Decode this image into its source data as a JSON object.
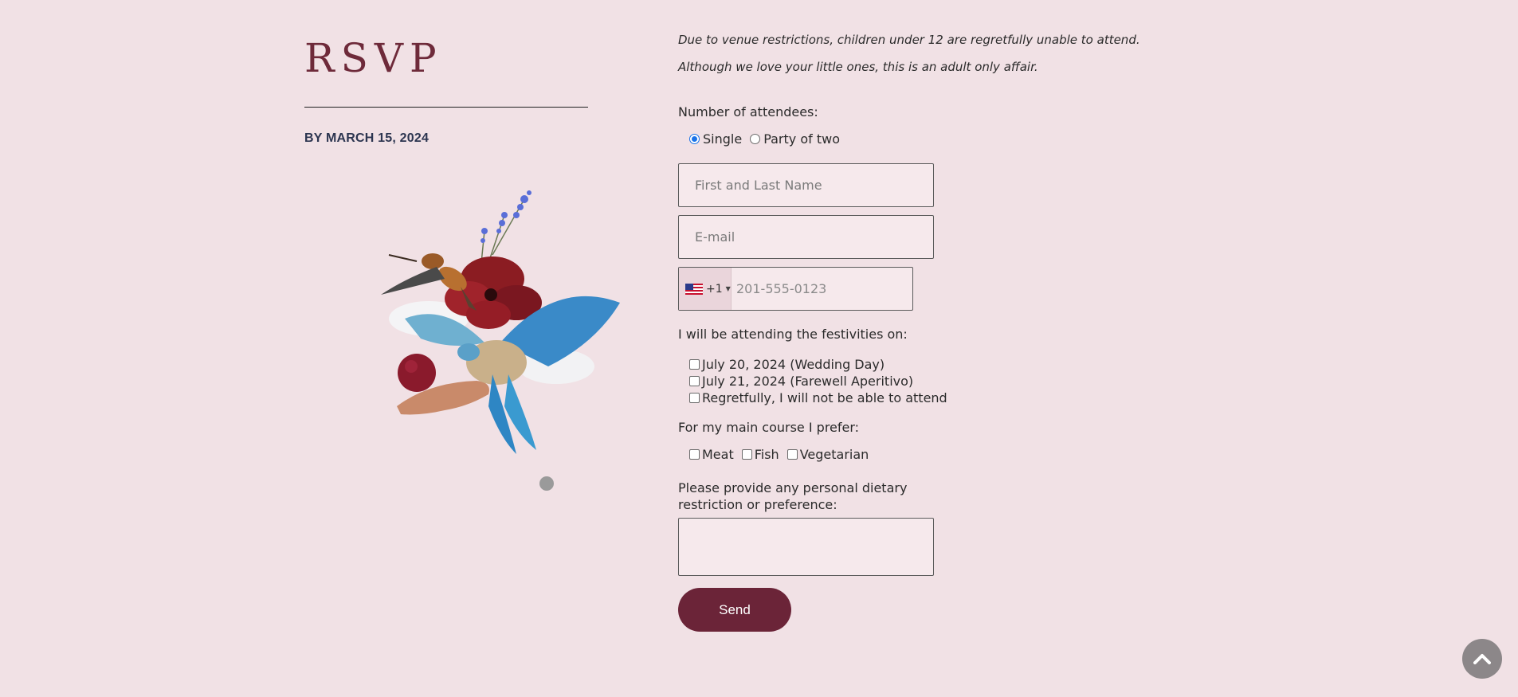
{
  "header": {
    "title": "RSVP",
    "deadline": "BY MARCH 15, 2024"
  },
  "notes": {
    "line1": "Due to venue restrictions, children under 12 are regretfully unable to attend.",
    "line2": "Although we love your little ones, this is an adult only affair."
  },
  "attendees": {
    "label": "Number of attendees:",
    "options": [
      "Single",
      "Party of two"
    ],
    "selected": "Single"
  },
  "fields": {
    "name_placeholder": "First and Last Name",
    "email_placeholder": "E-mail",
    "phone_country_code": "+1",
    "phone_placeholder": "201-555-0123"
  },
  "dates": {
    "label": "I will be attending the festivities on:",
    "options": [
      "July 20, 2024 (Wedding Day)",
      "July 21, 2024 (Farewell Aperitivo)",
      "Regretfully, I will not be able to attend"
    ]
  },
  "course": {
    "label": "For my main course I prefer:",
    "options": [
      "Meat",
      "Fish",
      "Vegetarian"
    ]
  },
  "dietary": {
    "label": "Please provide any personal dietary restriction or preference:"
  },
  "actions": {
    "send_label": "Send"
  },
  "icons": {
    "scroll_top": "chevron-up-icon",
    "flag": "us-flag-icon"
  },
  "colors": {
    "background": "#f1e1e5",
    "accent": "#6b2438",
    "title": "#6e2a3a",
    "radio_selected": "#1a73e8"
  }
}
